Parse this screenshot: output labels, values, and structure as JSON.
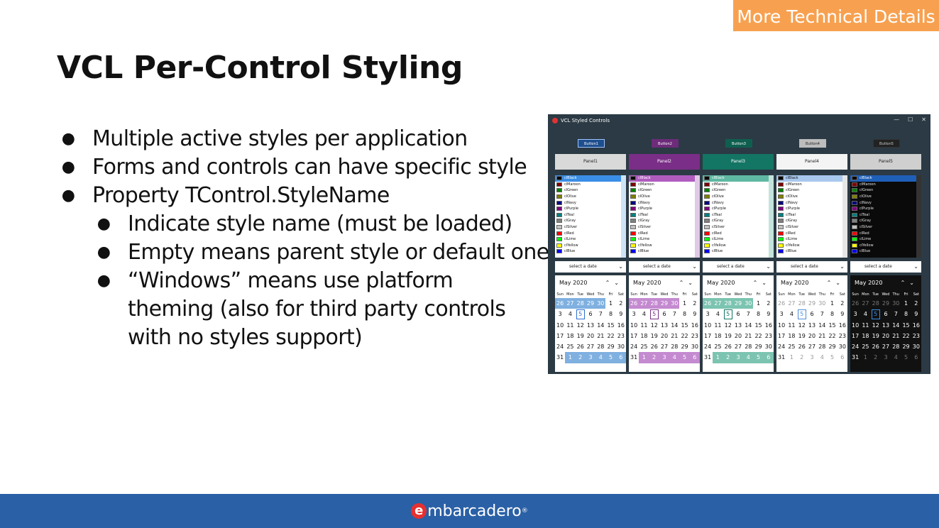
{
  "badge": "More Technical Details",
  "title": "VCL Per-Control Styling",
  "bullets": [
    {
      "text": "Multiple active styles per application",
      "level": 1
    },
    {
      "text": "Forms and controls can have specific style",
      "level": 1
    },
    {
      "text": "Property TControl.StyleName",
      "level": 1
    },
    {
      "text": "Indicate style name (must be loaded)",
      "level": 2
    },
    {
      "text": "Empty means parent style or default one",
      "level": 2
    },
    {
      "text": "“Windows” means use platform theming (also for third party controls with no styles support)",
      "level": 2
    }
  ],
  "footer": {
    "logo_mark": "e",
    "logo_text": "mbarcadero",
    "logo_reg": "®"
  },
  "window": {
    "title": "VCL Styled Controls",
    "controls": [
      "—",
      "☐",
      "✕"
    ],
    "date_placeholder": "select a date",
    "month_label": "May 2020",
    "weekdays": [
      "Sun",
      "Mon",
      "Tue",
      "Wed",
      "Thu",
      "Fri",
      "Sat"
    ],
    "colors": [
      {
        "name": "clBlack",
        "hex": "#000000"
      },
      {
        "name": "clMaroon",
        "hex": "#800000"
      },
      {
        "name": "clGreen",
        "hex": "#008000"
      },
      {
        "name": "clOlive",
        "hex": "#808000"
      },
      {
        "name": "clNavy",
        "hex": "#000080"
      },
      {
        "name": "clPurple",
        "hex": "#800080"
      },
      {
        "name": "clTeal",
        "hex": "#008080"
      },
      {
        "name": "clGray",
        "hex": "#808080"
      },
      {
        "name": "clSilver",
        "hex": "#c0c0c0"
      },
      {
        "name": "clRed",
        "hex": "#ff0000"
      },
      {
        "name": "clLime",
        "hex": "#00ff00"
      },
      {
        "name": "clYellow",
        "hex": "#ffff00"
      },
      {
        "name": "clBlue",
        "hex": "#0000ff"
      }
    ],
    "calendar": [
      {
        "d": "26",
        "o": true
      },
      {
        "d": "27",
        "o": true
      },
      {
        "d": "28",
        "o": true
      },
      {
        "d": "29",
        "o": true
      },
      {
        "d": "30",
        "o": true
      },
      {
        "d": "1"
      },
      {
        "d": "2"
      },
      {
        "d": "3"
      },
      {
        "d": "4"
      },
      {
        "d": "5",
        "t": true
      },
      {
        "d": "6"
      },
      {
        "d": "7"
      },
      {
        "d": "8"
      },
      {
        "d": "9"
      },
      {
        "d": "10"
      },
      {
        "d": "11"
      },
      {
        "d": "12"
      },
      {
        "d": "13"
      },
      {
        "d": "14"
      },
      {
        "d": "15"
      },
      {
        "d": "16"
      },
      {
        "d": "17"
      },
      {
        "d": "18"
      },
      {
        "d": "19"
      },
      {
        "d": "20"
      },
      {
        "d": "21"
      },
      {
        "d": "22"
      },
      {
        "d": "23"
      },
      {
        "d": "24"
      },
      {
        "d": "25"
      },
      {
        "d": "26"
      },
      {
        "d": "27"
      },
      {
        "d": "28"
      },
      {
        "d": "29"
      },
      {
        "d": "30"
      },
      {
        "d": "31"
      },
      {
        "d": "1",
        "o": true
      },
      {
        "d": "2",
        "o": true
      },
      {
        "d": "3",
        "o": true
      },
      {
        "d": "4",
        "o": true
      },
      {
        "d": "5",
        "o": true
      },
      {
        "d": "6",
        "o": true
      }
    ],
    "columns": [
      {
        "button": "Button1",
        "panel": "Panel1",
        "btnBg": "#1f4e8c",
        "btnFg": "#ffffff",
        "btnBorder": "#9cc3ff",
        "panelBg": "#d9d9d9",
        "panelFg": "#222222",
        "lbBg": "#ffffff",
        "lbFg": "#111111",
        "selBg": "#3a8ee6",
        "selFg": "#ffffff",
        "sbBg": "#cfe3f7",
        "dpBg": "#ffffff",
        "dpFg": "#222222",
        "calBg": "#ffffff",
        "calFg": "#111111",
        "otherBg": "#7fb0e0",
        "otherFg": "#ffffff",
        "todayFg": "#2d6fd0"
      },
      {
        "button": "Button2",
        "panel": "Panel2",
        "btnBg": "#6e2b7a",
        "btnFg": "#ffffff",
        "btnBorder": "#6e2b7a",
        "panelBg": "#7a2e87",
        "panelFg": "#ffffff",
        "lbBg": "#ffffff",
        "lbFg": "#111111",
        "selBg": "#b05cbf",
        "selFg": "#ffffff",
        "sbBg": "#e0c8e6",
        "dpBg": "#ffffff",
        "dpFg": "#222222",
        "calBg": "#ffffff",
        "calFg": "#111111",
        "otherBg": "#c48ad0",
        "otherFg": "#ffffff",
        "todayFg": "#7a2e87"
      },
      {
        "button": "Button3",
        "panel": "Panel3",
        "btnBg": "#0f5f4f",
        "btnFg": "#ffffff",
        "btnBorder": "#0f5f4f",
        "panelBg": "#137563",
        "panelFg": "#ffffff",
        "lbBg": "#ffffff",
        "lbFg": "#111111",
        "selBg": "#5fb8a2",
        "selFg": "#ffffff",
        "sbBg": "#c3e4dc",
        "dpBg": "#ffffff",
        "dpFg": "#222222",
        "calBg": "#ffffff",
        "calFg": "#111111",
        "otherBg": "#7cc4b1",
        "otherFg": "#ffffff",
        "todayFg": "#137563"
      },
      {
        "button": "Button4",
        "panel": "Panel4",
        "btnBg": "#bdbdbd",
        "btnFg": "#222222",
        "btnBorder": "#bdbdbd",
        "panelBg": "#f4f4f4",
        "panelFg": "#222222",
        "lbBg": "#ffffff",
        "lbFg": "#111111",
        "selBg": "#a9c8ee",
        "selFg": "#111111",
        "sbBg": "#e6e6e6",
        "dpBg": "#ffffff",
        "dpFg": "#222222",
        "calBg": "#ffffff",
        "calFg": "#111111",
        "otherBg": "#ffffff",
        "otherFg": "#999999",
        "todayFg": "#4f8fd8"
      },
      {
        "button": "Button5",
        "panel": "Panel5",
        "btnBg": "#222222",
        "btnFg": "#cccccc",
        "btnBorder": "#333333",
        "panelBg": "#cfcfcf",
        "panelFg": "#222222",
        "lbBg": "#0a0a0a",
        "lbFg": "#e0e0e0",
        "selBg": "#1e5fb8",
        "selFg": "#ffffff",
        "sbBg": "#333333",
        "dpBg": "#ffffff",
        "dpFg": "#222222",
        "calBg": "#111111",
        "calFg": "#ffffff",
        "otherBg": "#111111",
        "otherFg": "#777777",
        "todayFg": "#3a8ee6"
      }
    ]
  }
}
